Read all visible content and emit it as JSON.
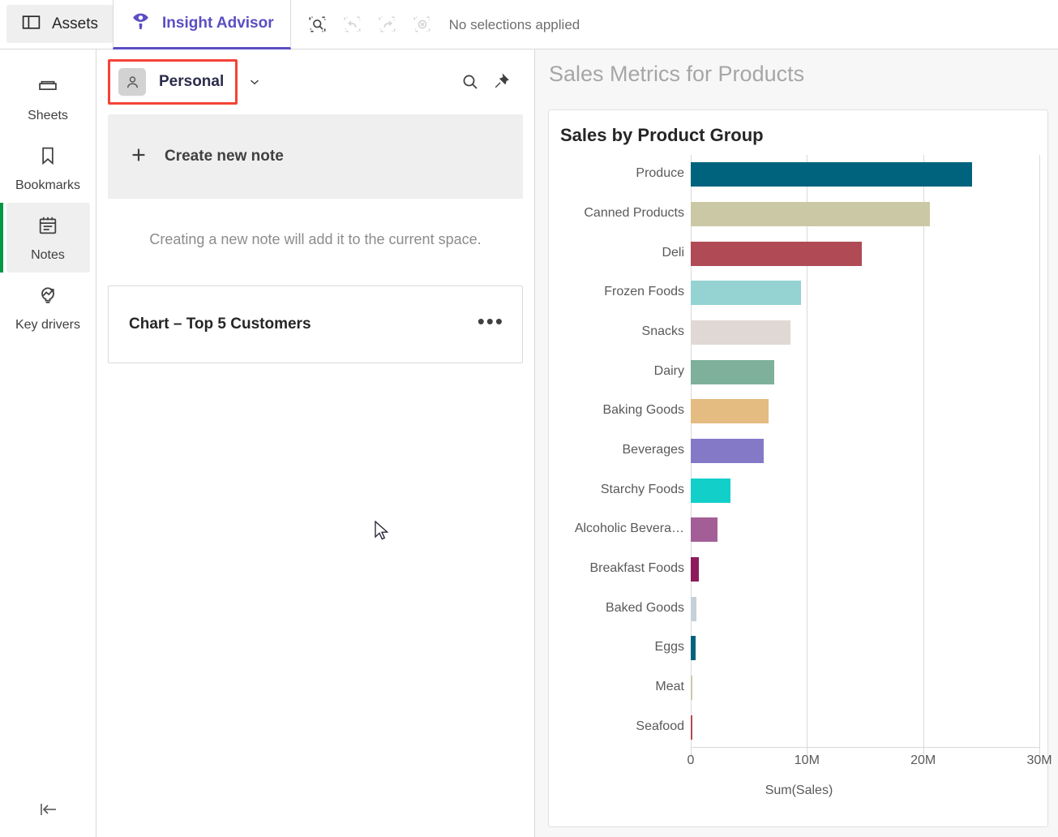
{
  "topbar": {
    "tabs": [
      {
        "label": "Assets",
        "icon": "panel-layout-icon",
        "active": false
      },
      {
        "label": "Insight Advisor",
        "icon": "insight-advisor-icon",
        "active": true
      }
    ],
    "tools": [
      {
        "name": "selections-tool-icon",
        "label": "Selections tool",
        "enabled": true
      },
      {
        "name": "undo-icon",
        "label": "Step back in selections",
        "enabled": false
      },
      {
        "name": "redo-icon",
        "label": "Step forward in selections",
        "enabled": false
      },
      {
        "name": "clear-selections-icon",
        "label": "Clear all selections",
        "enabled": false
      }
    ],
    "selections_status": "No selections applied"
  },
  "rail": {
    "items": [
      {
        "label": "Sheets",
        "icon": "sheets-icon",
        "active": false
      },
      {
        "label": "Bookmarks",
        "icon": "bookmark-icon",
        "active": false
      },
      {
        "label": "Notes",
        "icon": "notes-icon",
        "active": true
      },
      {
        "label": "Key drivers",
        "icon": "key-drivers-icon",
        "active": false
      }
    ],
    "collapse_label": "Collapse"
  },
  "notes_panel": {
    "space_name": "Personal",
    "space_avatar_icon": "person-icon",
    "caret_icon": "chevron-down-icon",
    "search_icon": "search-icon",
    "pin_icon": "pin-icon",
    "create_note_label": "Create new note",
    "create_note_icon": "plus-icon",
    "hint": "Creating a new note will add it to the current space.",
    "notes": [
      {
        "title": "Chart – Top 5 Customers",
        "menu_icon": "more-options-icon"
      }
    ]
  },
  "content": {
    "title": "Sales Metrics for Products"
  },
  "chart_data": {
    "type": "bar",
    "orientation": "horizontal",
    "title": "Sales by Product Group",
    "xlabel": "Sum(Sales)",
    "ylabel": "",
    "xlim": [
      0,
      30000000
    ],
    "xticks": [
      0,
      10000000,
      20000000,
      30000000
    ],
    "xtick_labels": [
      "0",
      "10M",
      "20M",
      "30M"
    ],
    "grid": true,
    "legend": "none",
    "categories": [
      "Produce",
      "Canned Products",
      "Deli",
      "Frozen Foods",
      "Snacks",
      "Dairy",
      "Baking Goods",
      "Beverages",
      "Starchy Foods",
      "Alcoholic Bevera…",
      "Breakfast Foods",
      "Baked Goods",
      "Eggs",
      "Meat",
      "Seafood"
    ],
    "values": [
      24200000,
      20600000,
      14700000,
      9500000,
      8600000,
      7200000,
      6700000,
      6300000,
      3400000,
      2300000,
      700000,
      500000,
      400000,
      120000,
      60000
    ],
    "colors": [
      "#00637e",
      "#cbc9a5",
      "#b04a55",
      "#94d3d2",
      "#e0d8d4",
      "#7eb09b",
      "#e4bb80",
      "#8479c7",
      "#12cfc9",
      "#a35e97",
      "#8e1b5c",
      "#c6d0d8",
      "#00637e",
      "#cbc9a5",
      "#b04a55"
    ]
  }
}
